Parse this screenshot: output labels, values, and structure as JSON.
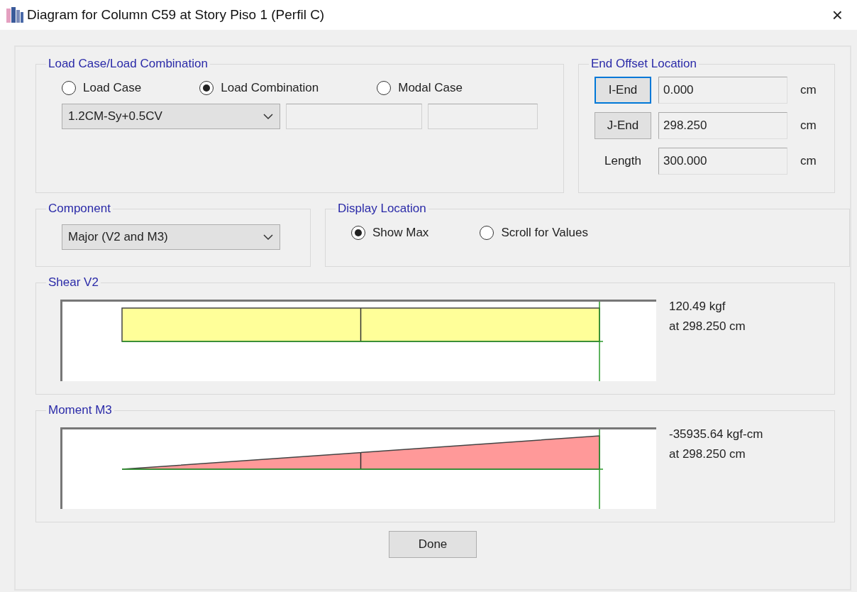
{
  "window": {
    "title": "Diagram for Column C59 at Story Piso 1 (Perfil C)",
    "close": "×"
  },
  "load_case_group": {
    "title": "Load Case/Load Combination",
    "options": [
      {
        "label": "Load Case",
        "selected": false
      },
      {
        "label": "Load Combination",
        "selected": true
      },
      {
        "label": "Modal Case",
        "selected": false
      }
    ],
    "combo": {
      "value": "1.2CM-Sy+0.5CV"
    }
  },
  "end_offset": {
    "title": "End Offset Location",
    "rows": [
      {
        "kind": "button",
        "label": "I-End",
        "focused": true,
        "value": "0.000",
        "unit": "cm"
      },
      {
        "kind": "button",
        "label": "J-End",
        "focused": false,
        "value": "298.250",
        "unit": "cm"
      },
      {
        "kind": "label",
        "label": "Length",
        "value": "300.000",
        "unit": "cm"
      }
    ]
  },
  "component": {
    "title": "Component",
    "value": "Major (V2 and M3)"
  },
  "display_location": {
    "title": "Display Location",
    "options": [
      {
        "label": "Show Max",
        "selected": true
      },
      {
        "label": "Scroll for Values",
        "selected": false
      }
    ]
  },
  "diagrams": [
    {
      "title": "Shear V2",
      "kind": "rectangle",
      "color": "#ffff99",
      "value": "120.49 kgf",
      "location": "at 298.250 cm"
    },
    {
      "title": "Moment M3",
      "kind": "triangle",
      "color": "#ff9999",
      "value": "-35935.64 kgf-cm",
      "location": "at 298.250 cm"
    }
  ],
  "buttons": [
    {
      "label": "Done"
    }
  ]
}
